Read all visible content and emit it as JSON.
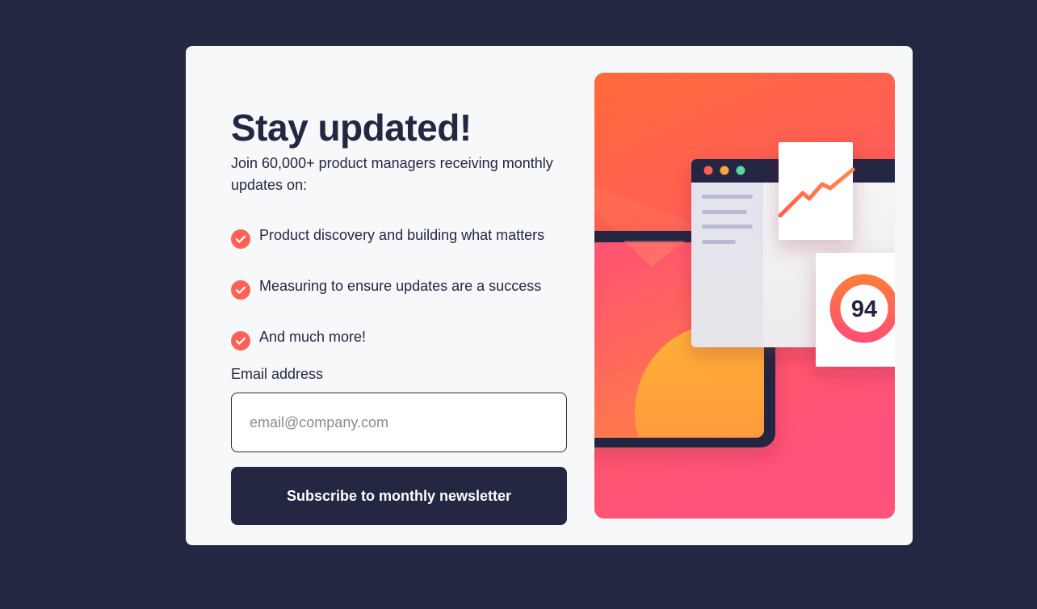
{
  "signup": {
    "title": "Stay updated!",
    "intro": "Join 60,000+ product managers receiving monthly updates on:",
    "features": [
      "Product discovery and building what matters",
      "Measuring to ensure updates are a success",
      "And much more!"
    ],
    "email_label": "Email address",
    "email_placeholder": "email@company.com",
    "email_value": "",
    "submit_label": "Subscribe to monthly newsletter"
  },
  "illustration": {
    "score": "94"
  },
  "colors": {
    "background": "#242742",
    "card": "#f7f8fa",
    "accent": "#ff6155",
    "gradient_top": "#ff6a3a",
    "gradient_bottom": "#ff527b"
  },
  "icons": {
    "feature_bullet": "check-icon"
  }
}
